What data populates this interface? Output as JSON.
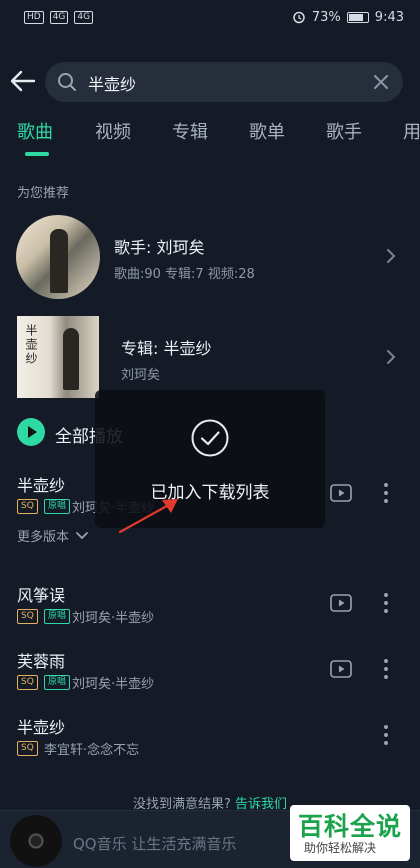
{
  "status_bar": {
    "left_badges": [
      "HD",
      "4G",
      "4G"
    ],
    "battery": "73%",
    "time": "9:43"
  },
  "search": {
    "query": "半壶纱"
  },
  "tabs": [
    {
      "label": "歌曲",
      "active": true
    },
    {
      "label": "视频",
      "active": false
    },
    {
      "label": "专辑",
      "active": false
    },
    {
      "label": "歌单",
      "active": false
    },
    {
      "label": "歌手",
      "active": false
    },
    {
      "label": "用",
      "active": false
    }
  ],
  "recommend": {
    "section_title": "为您推荐",
    "artist": {
      "title": "歌手: 刘珂矣",
      "subtitle": "歌曲:90 专辑:7 视频:28"
    },
    "album": {
      "title": "专辑: 半壶纱",
      "subtitle": "刘珂矣"
    }
  },
  "play_all": {
    "label": "全部播放"
  },
  "songs": [
    {
      "title": "半壶纱",
      "badges": [
        "SQ",
        "原唱"
      ],
      "meta": "刘珂矣·半壶纱"
    },
    {
      "title": "风筝误",
      "badges": [
        "SQ",
        "原唱"
      ],
      "meta": "刘珂矣·半壶纱"
    },
    {
      "title": "芙蓉雨",
      "badges": [
        "SQ",
        "原唱"
      ],
      "meta": "刘珂矣·半壶纱"
    },
    {
      "title": "半壶纱",
      "badges": [
        "SQ"
      ],
      "meta": "李宜轩·念念不忘"
    }
  ],
  "more_versions": {
    "label": "更多版本"
  },
  "bottom_hint": {
    "text": "没找到满意结果?",
    "link": "告诉我们"
  },
  "player": {
    "text": "QQ音乐 让生活充满音乐"
  },
  "toast": {
    "text": "已加入下载列表"
  },
  "watermark": {
    "title": "百科全说",
    "subtitle": "助你轻松解决"
  },
  "colors": {
    "accent": "#2fd9a4",
    "background": "#141a26",
    "sq_badge": "#e4b061"
  }
}
